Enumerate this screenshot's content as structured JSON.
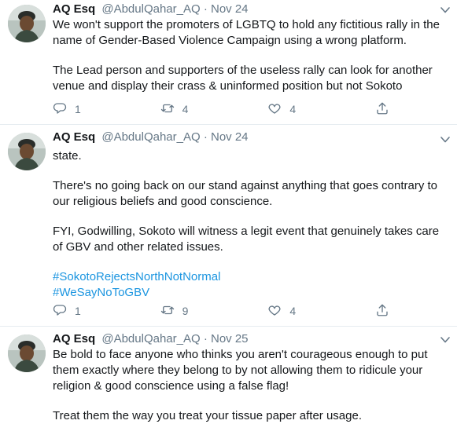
{
  "tweets": [
    {
      "name": "AQ Esq",
      "handle": "@AbdulQahar_AQ",
      "dot": "·",
      "date": "Nov 24",
      "paragraphs": [
        "We won't support the promoters of LGBTQ to hold any fictitious rally in the name of Gender-Based Violence Campaign using a wrong platform.",
        "The Lead person and supporters of the useless rally can look for another venue and display their crass & uninformed position but not Sokoto"
      ],
      "replies": "1",
      "retweets": "4",
      "likes": "4"
    },
    {
      "name": "AQ Esq",
      "handle": "@AbdulQahar_AQ",
      "dot": "·",
      "date": "Nov 24",
      "paragraphs": [
        "state.",
        "There's no going back on our stand against anything that goes contrary to our religious beliefs and good conscience.",
        "FYI, Godwilling, Sokoto will witness a legit event that genuinely takes care of GBV and other related issues."
      ],
      "hashtags": [
        "#SokotoRejectsNorthNotNormal",
        "#WeSayNoToGBV"
      ],
      "replies": "1",
      "retweets": "9",
      "likes": "4"
    },
    {
      "name": "AQ Esq",
      "handle": "@AbdulQahar_AQ",
      "dot": "·",
      "date": "Nov 25",
      "paragraphs": [
        "Be bold to face anyone who thinks you aren't courageous enough to put them exactly where they belong to by not allowing them to ridicule your religion & good conscience using a false flag!",
        "Treat them the way you treat your tissue paper after usage."
      ]
    }
  ],
  "icons": {
    "reply": "reply-icon",
    "retweet": "retweet-icon",
    "like": "heart-icon",
    "share": "share-icon",
    "caret": "chevron-down-icon"
  },
  "colors": {
    "text": "#14171a",
    "muted": "#657786",
    "link": "#1b95e0",
    "divider": "#e6ecf0"
  }
}
